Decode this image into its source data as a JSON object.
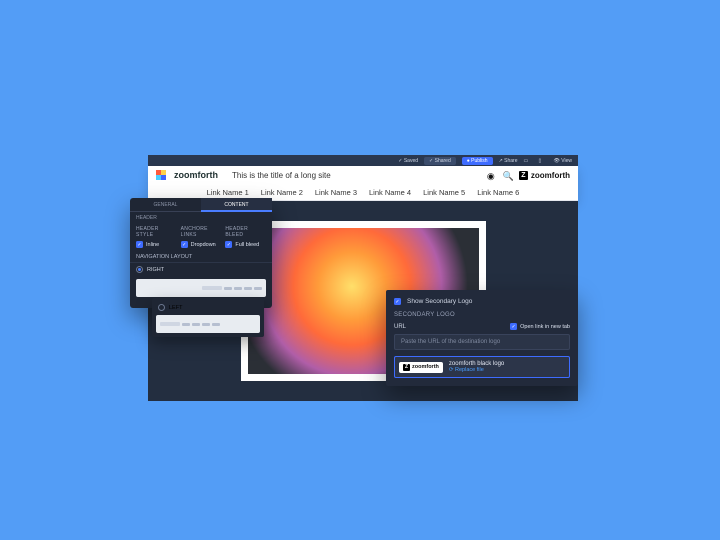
{
  "topbar": {
    "items": [
      "Saved",
      "Shared",
      "Publish",
      "Share"
    ],
    "view": "View",
    "active_index": 2
  },
  "header": {
    "brand": "zoomforth",
    "title": "This is the title of a long site",
    "secondary_brand": "zoomforth",
    "nav": [
      "Link Name 1",
      "Link Name 2",
      "Link Name 3",
      "Link Name 4",
      "Link Name 5",
      "Link Name 6"
    ]
  },
  "left_panel": {
    "tabs": [
      "GENERAL",
      "CONTENT"
    ],
    "active_tab": 1,
    "subhead": "HEADER",
    "cols": [
      {
        "h": "HEADER STYLE",
        "label": "Inline",
        "checked": true
      },
      {
        "h": "ANCHORE LINKS",
        "label": "Dropdown",
        "checked": true
      },
      {
        "h": "HEADER BLEED",
        "label": "Full bleed",
        "checked": true
      }
    ],
    "layout_h": "NAVIGATION LAYOUT",
    "options": [
      {
        "label": "RIGHT",
        "selected": true
      },
      {
        "label": "LEFT",
        "selected": false
      }
    ]
  },
  "right_panel": {
    "show_secondary": {
      "label": "Show Secondary Logo",
      "checked": true
    },
    "section_h": "SECONDARY LOGO",
    "url_label": "URL",
    "newtab": {
      "label": "Open link in new tab",
      "checked": true
    },
    "placeholder": "Paste the URL of the destination logo",
    "file": {
      "badge": "zoomforth",
      "name": "zoomforth black logo",
      "replace": "Replace file"
    }
  }
}
